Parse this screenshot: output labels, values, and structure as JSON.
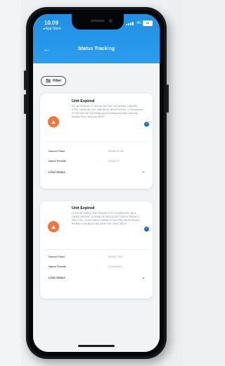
{
  "status_bar": {
    "time": "10.09",
    "back_store": "◂ App Store",
    "network": "4G",
    "battery": "88"
  },
  "header": {
    "title": "Status Tracking"
  },
  "filter": {
    "label": "Filter"
  },
  "cards": [
    {
      "status": "Unit Expired",
      "address": "DS. KETAPANG XT 002 Rw 002 KEC KETAPANG LAMUSE RTPG LAMPUNG 001 18W MILIK WEAPONS Se. 4, Peristirahat ST 002 RW 002 Kel Ketapang Kec Ketapang Kota Lampung Selatan Prov Lampung 35592",
      "rows": [
        {
          "label": "Nomor Polisi",
          "value": "BE6870CAF"
        },
        {
          "label": "Nama Pemilik",
          "value": "JANA ST"
        }
      ],
      "detail_label": "Lihat Status"
    },
    {
      "status": "Unit Expired",
      "address": "JL.PESAH BARU LIME TRANSITO RT 09 BESERSI HAUL LARAS BELANG GUDANG BONGSOKAN TAMIYA PINKAH 1 RW 10 B.1 JUJUR PANG KAMAN ET 003 RW 008 Kel Bawan Kel Baru Kota Baru Kota Jambi Prov Jambi 36125",
      "rows": [
        {
          "label": "Nomor Polisi",
          "value": "BH4877RU"
        },
        {
          "label": "Nama Pemilik",
          "value": "SITA WATI"
        }
      ],
      "detail_label": "Lihat Status"
    }
  ],
  "colors": {
    "primary": "#2196f3",
    "warning": "#f5743a",
    "badge": "#1b6fd0"
  }
}
